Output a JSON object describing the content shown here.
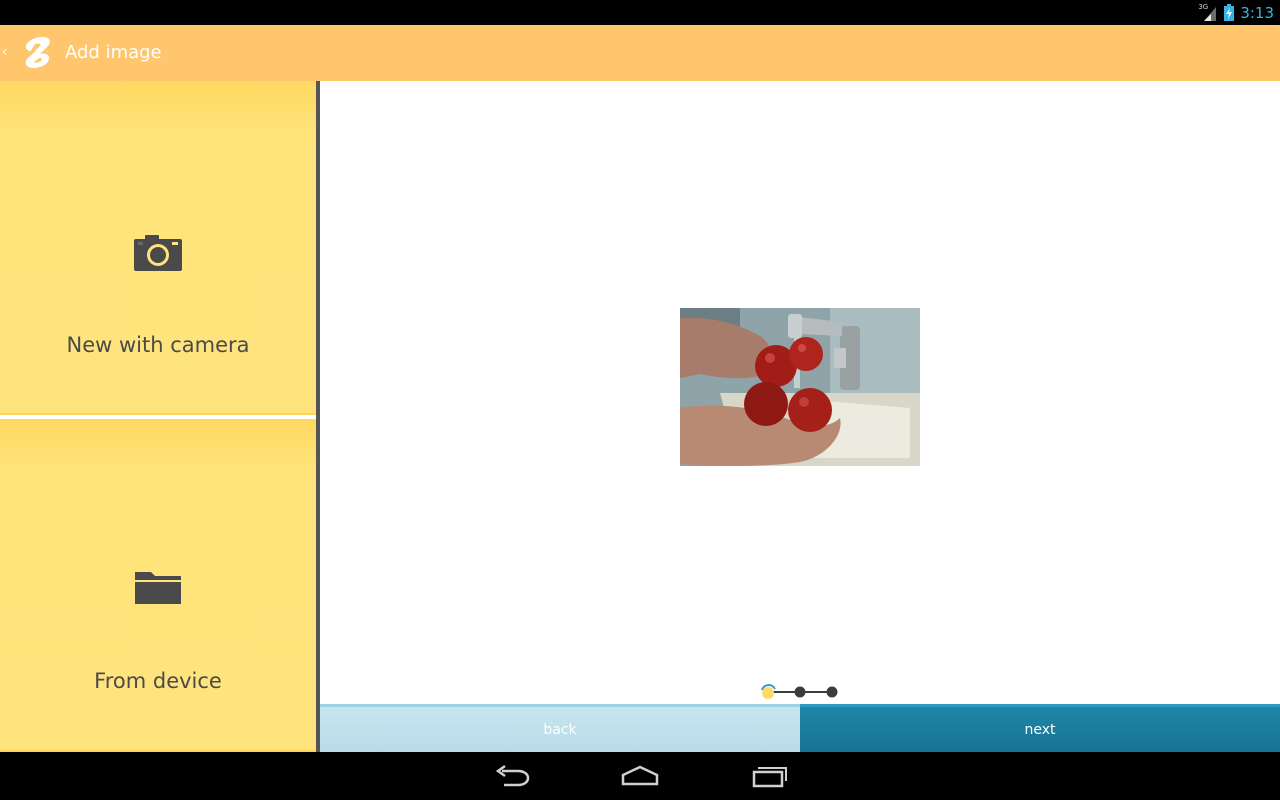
{
  "status_bar": {
    "network": "3G",
    "time": "3:13",
    "clock_color": "#33b5e5"
  },
  "action_bar": {
    "title": "Add image",
    "background": "#ffc66e"
  },
  "sources": [
    {
      "label": "New with camera",
      "icon": "camera-icon"
    },
    {
      "label": "From device",
      "icon": "folder-icon"
    }
  ],
  "preview": {
    "subject": "photo of hands washing tomatoes under a faucet"
  },
  "pager": {
    "steps": 3,
    "current": 1
  },
  "buttons": {
    "back": "back",
    "next": "next"
  },
  "nav_bar": {
    "items": [
      "back-icon",
      "home-icon",
      "recent-apps-icon"
    ]
  }
}
